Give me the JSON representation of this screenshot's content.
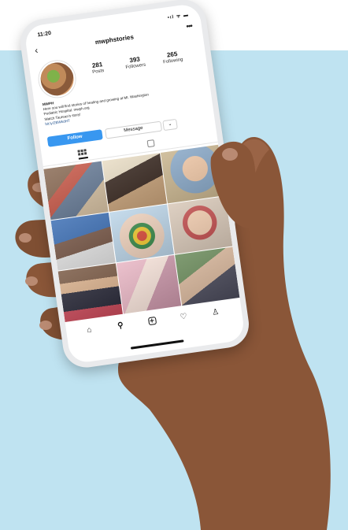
{
  "status_bar": {
    "time": "11:20",
    "icons": "•ıl ᯤ ▬"
  },
  "nav": {
    "title": "mwphstories",
    "back_icon": "‹",
    "more_icon": "•••"
  },
  "profile": {
    "stats": [
      {
        "value": "281",
        "label": "Posts"
      },
      {
        "value": "393",
        "label": "Followers"
      },
      {
        "value": "265",
        "label": "Following"
      }
    ]
  },
  "bio": {
    "name": "MWPH",
    "line1": "Here you will find stories of healing and growing at Mt. Washington",
    "line2": "Pediatric Hospital. mwph.org",
    "line3": "Watch Taurean's story!",
    "link": "bit.ly/2BWkdHT"
  },
  "buttons": {
    "follow": "Follow",
    "message": "Message",
    "dropdown": "⌄"
  },
  "bottom_nav": {
    "home": "⌂",
    "search": "⚲",
    "heart": "♡",
    "profile": "♙"
  },
  "colors": {
    "background_panel": "#bfe3f1",
    "follow_button": "#3897f0",
    "skin": "#8a5638"
  }
}
